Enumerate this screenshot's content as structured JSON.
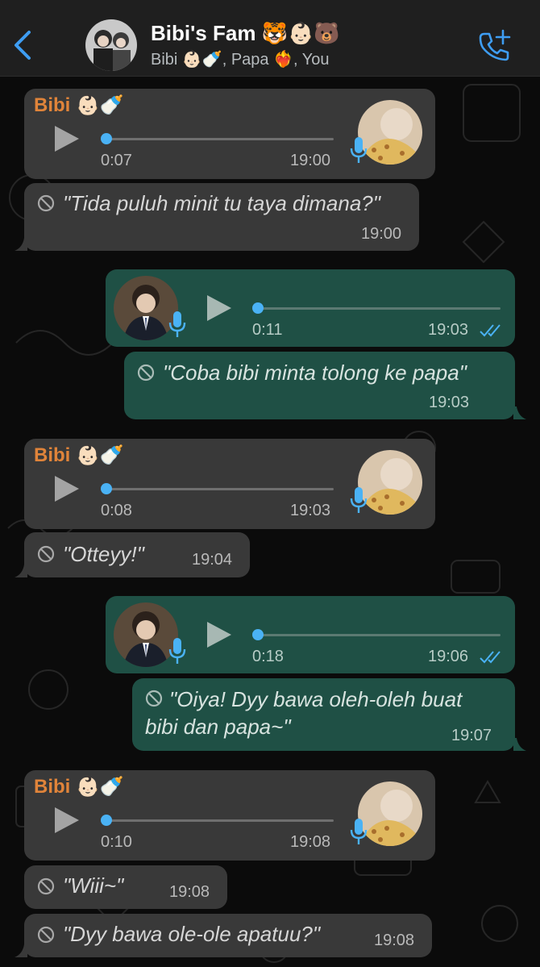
{
  "header": {
    "title": "Bibi's Fam 🐯👶🏻🐻",
    "subtitle": "Bibi 👶🏻🍼, Papa ❤️‍🔥, You"
  },
  "colors": {
    "incoming_bubble": "#393939",
    "outgoing_bubble": "#1f5045",
    "sender_name": "#e0843a",
    "accent_blue": "#4ab2f5"
  },
  "messages": [
    {
      "type": "voice",
      "direction": "in",
      "sender": "Bibi 👶🏻🍼",
      "duration": "0:07",
      "time": "19:00"
    },
    {
      "type": "deleted",
      "direction": "in",
      "text": "\"Tida puluh minit tu taya dimana?\"",
      "time": "19:00"
    },
    {
      "type": "voice",
      "direction": "out",
      "duration": "0:11",
      "time": "19:03",
      "status": "read"
    },
    {
      "type": "deleted",
      "direction": "out",
      "text": "\"Coba bibi minta tolong ke papa\"",
      "time": "19:03"
    },
    {
      "type": "voice",
      "direction": "in",
      "sender": "Bibi 👶🏻🍼",
      "duration": "0:08",
      "time": "19:03"
    },
    {
      "type": "deleted",
      "direction": "in",
      "text": "\"Otteyy!\"",
      "time": "19:04"
    },
    {
      "type": "voice",
      "direction": "out",
      "duration": "0:18",
      "time": "19:06",
      "status": "read"
    },
    {
      "type": "deleted",
      "direction": "out",
      "text_line1": "\"Oiya! Dyy bawa oleh-oleh buat",
      "text_line2": "bibi dan papa~\"",
      "time": "19:07"
    },
    {
      "type": "voice",
      "direction": "in",
      "sender": "Bibi 👶🏻🍼",
      "duration": "0:10",
      "time": "19:08"
    },
    {
      "type": "deleted",
      "direction": "in",
      "text": "\"Wiii~\"",
      "time": "19:08"
    },
    {
      "type": "deleted",
      "direction": "in",
      "text": "\"Dyy bawa ole-ole apatuu?\"",
      "time": "19:08"
    }
  ]
}
